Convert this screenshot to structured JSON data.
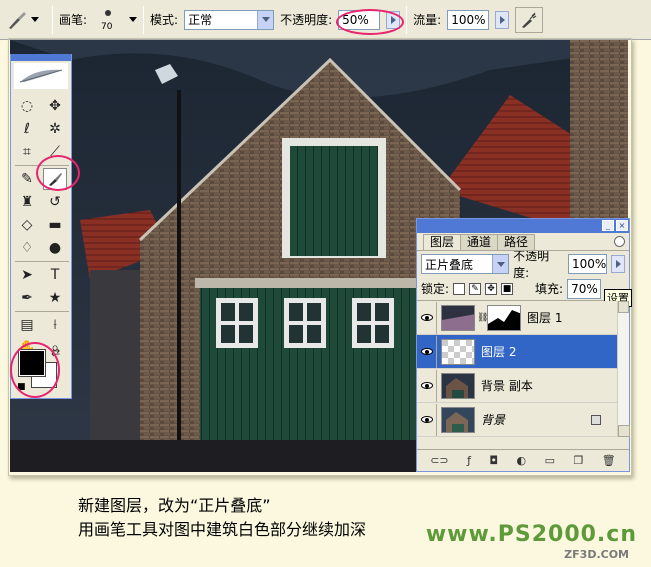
{
  "options_bar": {
    "brush_label": "画笔:",
    "brush_size": "70",
    "mode_label": "模式:",
    "mode_value": "正常",
    "opacity_label": "不透明度:",
    "opacity_value": "50%",
    "flow_label": "流量:",
    "flow_value": "100%"
  },
  "toolbox": {
    "tools": [
      "marquee-tool",
      "move-tool",
      "lasso-tool",
      "magic-wand-tool",
      "crop-tool",
      "slice-tool",
      "healing-brush-tool",
      "brush-tool",
      "clone-stamp-tool",
      "history-brush-tool",
      "eraser-tool",
      "gradient-tool",
      "blur-tool",
      "dodge-tool",
      "path-selection-tool",
      "type-tool",
      "pen-tool",
      "shape-tool",
      "notes-tool",
      "eyedropper-tool",
      "hand-tool",
      "zoom-tool"
    ],
    "foreground_color": "#000000",
    "background_color": "#ffffff"
  },
  "layers_panel": {
    "tabs": [
      "图层",
      "通道",
      "路径"
    ],
    "blend_mode": "正片叠底",
    "opacity_label": "不透明度:",
    "opacity_value": "100%",
    "lock_label": "锁定:",
    "fill_label": "填充:",
    "fill_value": "70%",
    "tooltip": "设置",
    "layers": [
      {
        "name": "图层 1",
        "selected": false,
        "has_mask": true
      },
      {
        "name": "图层 2",
        "selected": true,
        "has_mask": false
      },
      {
        "name": "背景 副本",
        "selected": false,
        "has_mask": false
      },
      {
        "name": "背景",
        "selected": false,
        "has_mask": false,
        "locked": true
      }
    ]
  },
  "caption": {
    "line1": "新建图层，改为“正片叠底”",
    "line2": "用画笔工具对图中建筑白色部分继续加深"
  },
  "watermark": {
    "main": "www.PS2000.cn",
    "sub": "ZF3D.COM"
  },
  "colors": {
    "annotation_circle": "#e8246f",
    "panel_title_bar": "#4f79d4",
    "selected_layer": "#3166c7",
    "caption_background": "#fbf8df",
    "watermark_green": "#5f9a3a"
  }
}
